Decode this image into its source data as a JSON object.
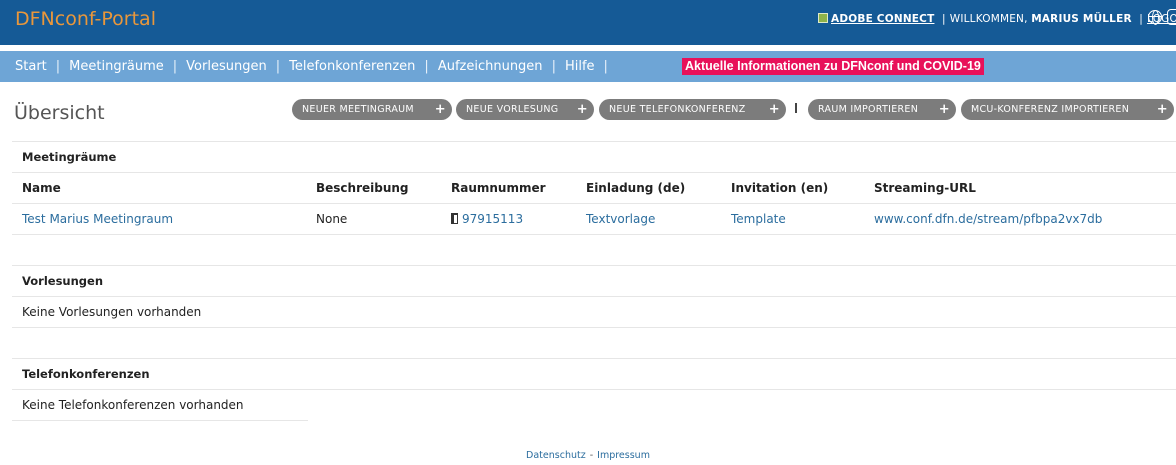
{
  "header": {
    "brand": "DFNconf-Portal",
    "adobe_connect": "ADOBE CONNECT",
    "welcome_prefix": "WILLKOMMEN,",
    "user_name": "MARIUS MÜLLER",
    "logout": "LOGOUT",
    "separator": "|"
  },
  "nav": {
    "items": [
      {
        "label": "Start"
      },
      {
        "label": "Meetingräume"
      },
      {
        "label": "Vorlesungen"
      },
      {
        "label": "Telefonkonferenzen"
      },
      {
        "label": "Aufzeichnungen"
      },
      {
        "label": "Hilfe"
      }
    ],
    "separator": "|",
    "covid_banner": "Aktuelle Informationen zu DFNconf und COVID-19",
    "covid_color": "#e8115a"
  },
  "page": {
    "title": "Übersicht"
  },
  "actions": {
    "new_meetingroom": "NEUER MEETINGRAUM",
    "new_lecture": "NEUE VORLESUNG",
    "new_phoneconf": "NEUE TELEFONKONFERENZ",
    "separator": "I",
    "import_room": "RAUM IMPORTIEREN",
    "import_mcu": "MCU-KONFERENZ IMPORTIEREN",
    "plus": "+"
  },
  "meetingrooms": {
    "title": "Meetingräume",
    "columns": [
      "Name",
      "Beschreibung",
      "Raumnummer",
      "Einladung (de)",
      "Invitation (en)",
      "Streaming-URL"
    ],
    "rows": [
      {
        "name": "Test Marius Meetingraum",
        "description": "None",
        "room_number": "97915113",
        "invitation_de": "Textvorlage",
        "invitation_en": "Template",
        "streaming_url": "www.conf.dfn.de/stream/pfbpa2vx7db"
      }
    ]
  },
  "lectures": {
    "title": "Vorlesungen",
    "empty": "Keine Vorlesungen vorhanden"
  },
  "phoneconfs": {
    "title": "Telefonkonferenzen",
    "empty": "Keine Telefonkonferenzen vorhanden"
  },
  "footer": {
    "privacy": "Datenschutz",
    "separator": "-",
    "imprint": "Impressum"
  },
  "colors": {
    "header_bg": "#155a96",
    "nav_bg": "#6ea5d6",
    "brand": "#e9973b",
    "button_bg": "#7c7c7c",
    "link": "#2b6d9e"
  }
}
